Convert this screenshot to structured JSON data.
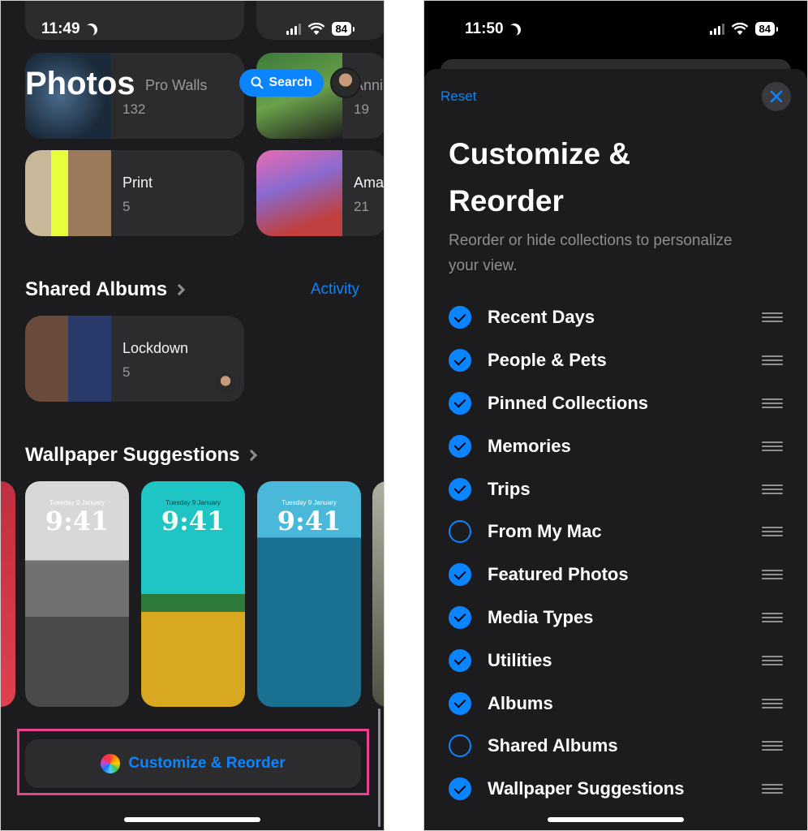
{
  "left": {
    "status": {
      "time": "11:49",
      "battery": "84"
    },
    "title": "Photos",
    "search_label": "Search",
    "top_albums": [
      {
        "name": "Pro Walls",
        "count": "132"
      },
      {
        "name": "Anni",
        "count": "19"
      },
      {
        "name": "Print",
        "count": "5"
      },
      {
        "name": "Ama",
        "count": "21"
      }
    ],
    "shared_albums_title": "Shared Albums",
    "activity_label": "Activity",
    "shared_album": {
      "name": "Lockdown",
      "count": "5"
    },
    "wallpaper_title": "Wallpaper Suggestions",
    "wallpapers": [
      {
        "date": "Tuesday 9 January",
        "time": "9:41"
      },
      {
        "date": "Tuesday 9 January",
        "time": "9:41"
      },
      {
        "date": "Tuesday 9 January",
        "time": "9:41"
      }
    ],
    "customize_label": "Customize & Reorder"
  },
  "right": {
    "status": {
      "time": "11:50",
      "battery": "84"
    },
    "reset_label": "Reset",
    "title": "Customize & Reorder",
    "description": "Reorder or hide collections to personalize your view.",
    "items": [
      {
        "label": "Recent Days",
        "checked": true
      },
      {
        "label": "People & Pets",
        "checked": true
      },
      {
        "label": "Pinned Collections",
        "checked": true
      },
      {
        "label": "Memories",
        "checked": true
      },
      {
        "label": "Trips",
        "checked": true
      },
      {
        "label": "From My Mac",
        "checked": false
      },
      {
        "label": "Featured Photos",
        "checked": true
      },
      {
        "label": "Media Types",
        "checked": true
      },
      {
        "label": "Utilities",
        "checked": true
      },
      {
        "label": "Albums",
        "checked": true
      },
      {
        "label": "Shared Albums",
        "checked": false
      },
      {
        "label": "Wallpaper Suggestions",
        "checked": true
      }
    ]
  },
  "colors": {
    "accent": "#0a84ff",
    "highlight": "#e8418f",
    "background": "#1c1c1e"
  }
}
